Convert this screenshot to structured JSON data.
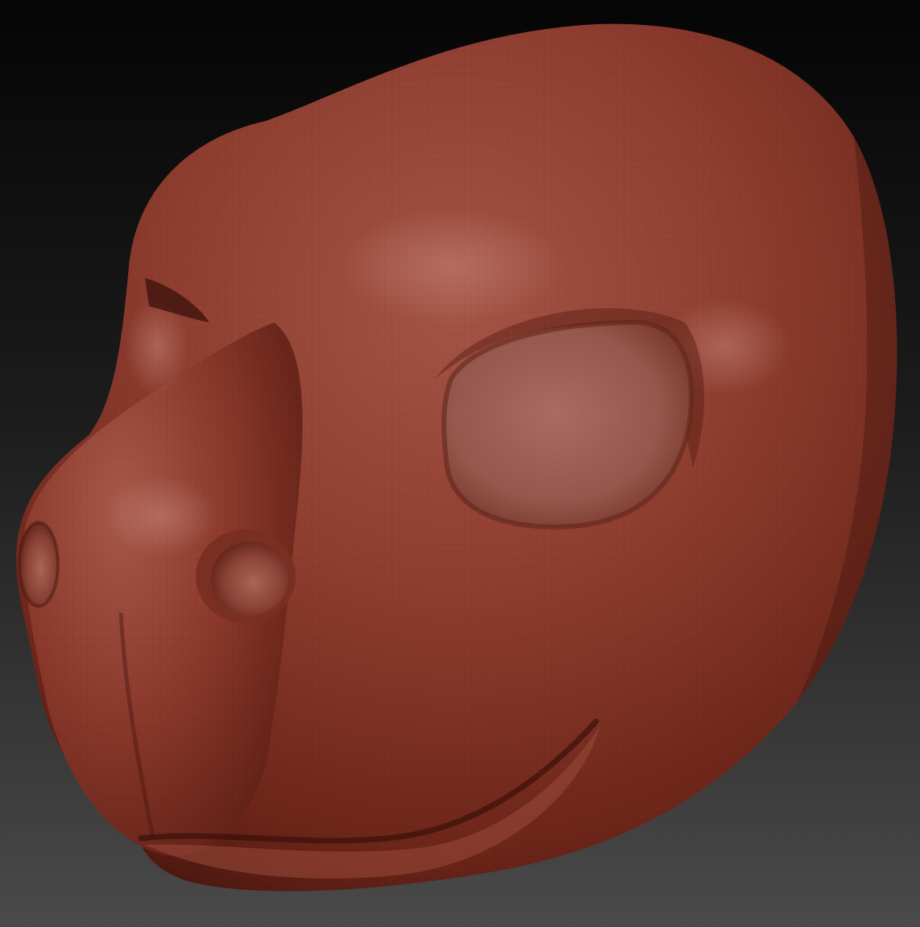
{
  "scene": {
    "subject": "sculpted-head-model",
    "colors": {
      "background_top": "#050505",
      "background_bottom": "#4a4a4a",
      "clay_highlight": "#b06a5e",
      "clay_mid": "#8c3a2c",
      "clay_shadow": "#4a1710",
      "eye_socket": "#9e6158"
    }
  }
}
